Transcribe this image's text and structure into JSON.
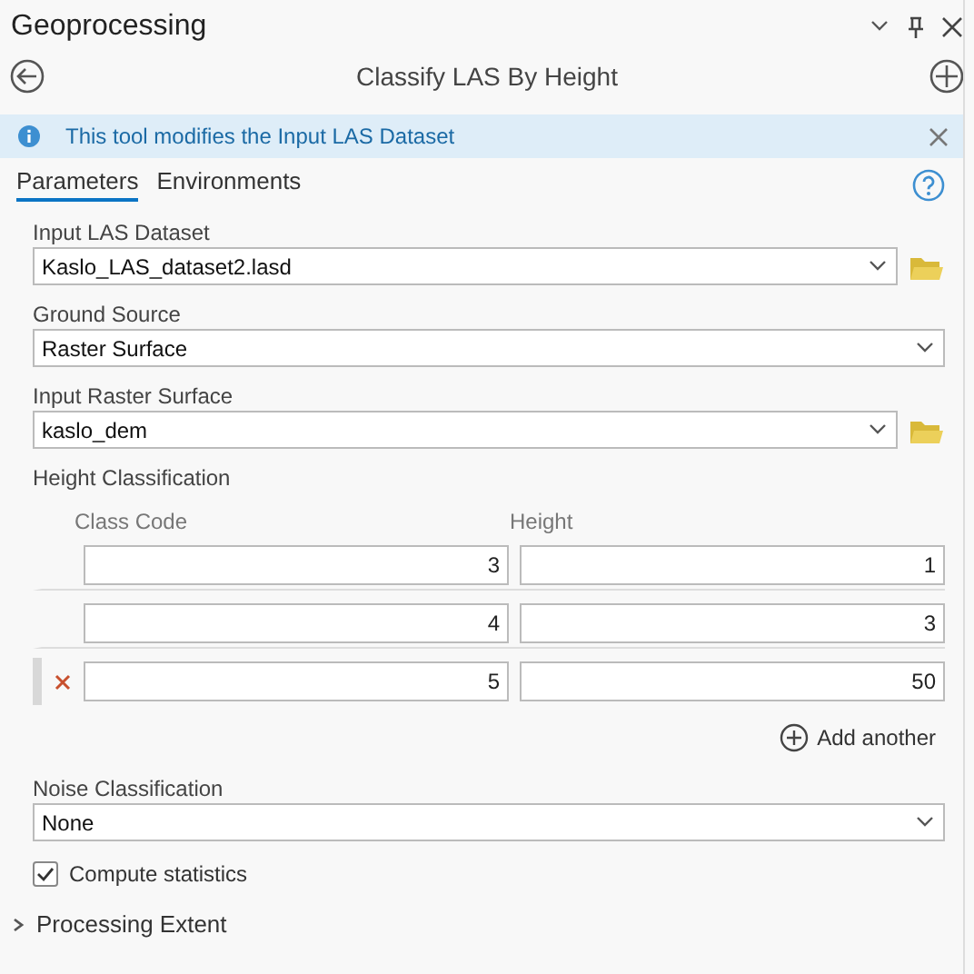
{
  "pane": {
    "title": "Geoprocessing"
  },
  "tool": {
    "title": "Classify LAS By Height"
  },
  "message": {
    "text": "This tool modifies the Input LAS Dataset"
  },
  "tabs": [
    {
      "label": "Parameters",
      "selected": true
    },
    {
      "label": "Environments",
      "selected": false
    }
  ],
  "parameters": [
    {
      "kind": "dataset",
      "label": "Input LAS Dataset",
      "value": "Kaslo_LAS_dataset2.lasd"
    },
    {
      "kind": "choice",
      "label": "Ground Source",
      "value": "Raster Surface"
    },
    {
      "kind": "dataset",
      "label": "Input Raster Surface",
      "value": "kaslo_dem"
    }
  ],
  "height_classification": {
    "label": "Height Classification",
    "columns": [
      "Class Code",
      "Height"
    ],
    "rows": [
      {
        "cells": [
          "3",
          "1"
        ],
        "selected": false
      },
      {
        "cells": [
          "4",
          "3"
        ],
        "selected": false
      },
      {
        "cells": [
          "5",
          "50"
        ],
        "selected": true
      }
    ],
    "add_button": "Add another"
  },
  "noise": {
    "kind": "choice",
    "label": "Noise Classification",
    "value": "None"
  },
  "compute_statistics": {
    "label": "Compute statistics",
    "checked": true
  },
  "sections": [
    {
      "label": "Processing Extent",
      "expanded": false
    }
  ]
}
